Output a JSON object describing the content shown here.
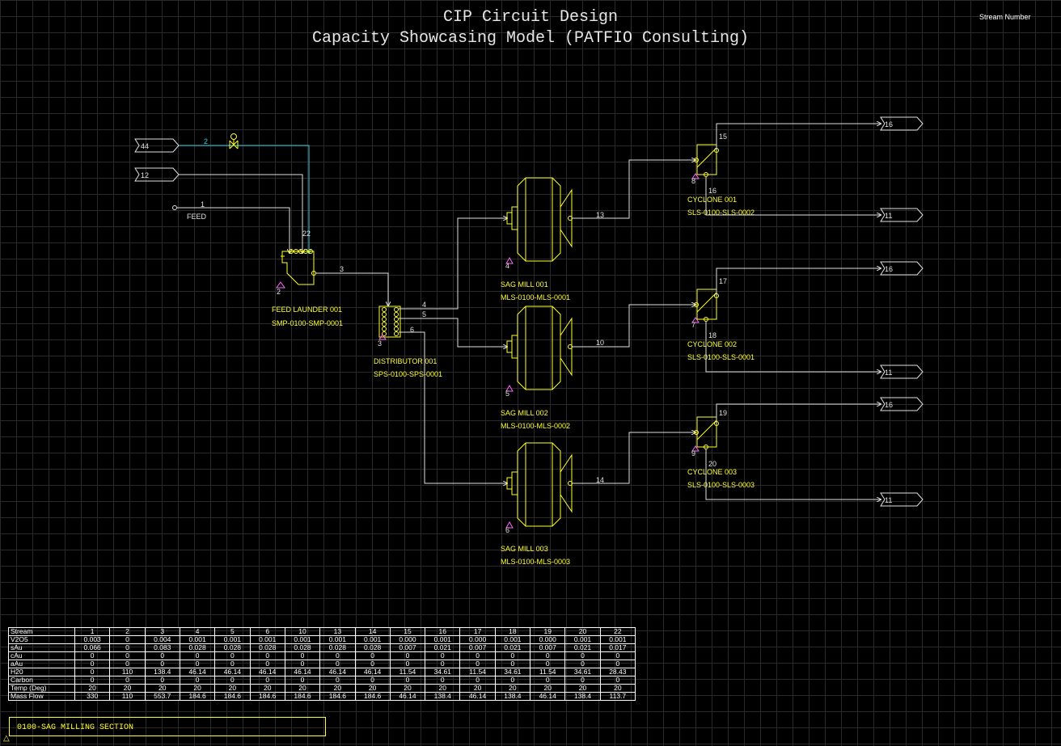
{
  "header": {
    "title": "CIP Circuit Design",
    "subtitle": "Capacity Showcasing Model (PATFIO Consulting)",
    "legend_label": "Stream Number"
  },
  "colors": {
    "background": "#000000",
    "grid": "#2a2a2a",
    "equipment": "#ffff33",
    "stream_line": "#e0e0e0",
    "water_line": "#39d0e0",
    "node_marker": "#ff66ff"
  },
  "feeds": [
    {
      "tag": "44"
    },
    {
      "tag": "12"
    },
    {
      "tag": "FEED"
    }
  ],
  "outlets": [
    {
      "tag": "16"
    },
    {
      "tag": "11"
    },
    {
      "tag": "16"
    },
    {
      "tag": "11"
    },
    {
      "tag": "16"
    },
    {
      "tag": "11"
    }
  ],
  "equipment": {
    "feed_launder": {
      "name": "FEED LAUNDER 001",
      "code": "SMP-0100-SMP-0001",
      "node": "2"
    },
    "distributor": {
      "name": "DISTRIBUTOR 001",
      "code": "SPS-0100-SPS-0001",
      "node": "3"
    },
    "sag_mill_1": {
      "name": "SAG MILL 001",
      "code": "MLS-0100-MLS-0001",
      "node": "4"
    },
    "sag_mill_2": {
      "name": "SAG MILL 002",
      "code": "MLS-0100-MLS-0002",
      "node": "5"
    },
    "sag_mill_3": {
      "name": "SAG MILL 003",
      "code": "MLS-0100-MLS-0003",
      "node": "6"
    },
    "cyclone_1": {
      "name": "CYCLONE 001",
      "code": "SLS-0100-SLS-0002",
      "node": "8"
    },
    "cyclone_2": {
      "name": "CYCLONE 002",
      "code": "SLS-0100-SLS-0001",
      "node": "7"
    },
    "cyclone_3": {
      "name": "CYCLONE 003",
      "code": "SLS-0100-SLS-0003",
      "node": "9"
    }
  },
  "streams": {
    "s1": "1",
    "s2": "2",
    "s3": "3",
    "s4": "4",
    "s5": "5",
    "s6": "6",
    "s10": "10",
    "s13": "13",
    "s14": "14",
    "s15": "15",
    "s16": "16",
    "s17": "17",
    "s18": "18",
    "s19": "19",
    "s20": "20",
    "s22": "22"
  },
  "stream_table": {
    "columns": [
      "Stream",
      "1",
      "2",
      "3",
      "4",
      "5",
      "6",
      "10",
      "13",
      "14",
      "15",
      "16",
      "17",
      "18",
      "19",
      "20",
      "22"
    ],
    "rows": [
      [
        "V2O5",
        "0.003",
        "0",
        "0.004",
        "0.001",
        "0.001",
        "0.001",
        "0.001",
        "0.001",
        "0.001",
        "0.000",
        "0.001",
        "0.000",
        "0.001",
        "0.000",
        "0.001",
        "0.001"
      ],
      [
        "sAu",
        "0.066",
        "0",
        "0.083",
        "0.028",
        "0.028",
        "0.028",
        "0.028",
        "0.028",
        "0.028",
        "0.007",
        "0.021",
        "0.007",
        "0.021",
        "0.007",
        "0.021",
        "0.017"
      ],
      [
        "cAu",
        "0",
        "0",
        "0",
        "0",
        "0",
        "0",
        "0",
        "0",
        "0",
        "0",
        "0",
        "0",
        "0",
        "0",
        "0",
        "0"
      ],
      [
        "aAu",
        "0",
        "0",
        "0",
        "0",
        "0",
        "0",
        "0",
        "0",
        "0",
        "0",
        "0",
        "0",
        "0",
        "0",
        "0",
        "0"
      ],
      [
        "H20",
        "0",
        "110",
        "138.4",
        "46.14",
        "46.14",
        "46.14",
        "46.14",
        "46.14",
        "46.14",
        "11.54",
        "34.61",
        "11.54",
        "34.61",
        "11.54",
        "34.61",
        "28.43"
      ],
      [
        "Carbon",
        "0",
        "0",
        "0",
        "0",
        "0",
        "0",
        "0",
        "0",
        "0",
        "0",
        "0",
        "0",
        "0",
        "0",
        "0",
        "0"
      ],
      [
        "Temp (Deg)",
        "20",
        "20",
        "20",
        "20",
        "20",
        "20",
        "20",
        "20",
        "20",
        "20",
        "20",
        "20",
        "20",
        "20",
        "20",
        "20"
      ],
      [
        "Mass Flow",
        "330",
        "110",
        "553.7",
        "184.6",
        "184.6",
        "184.6",
        "184.6",
        "184.6",
        "184.6",
        "46.14",
        "138.4",
        "46.14",
        "138.4",
        "46.14",
        "138.4",
        "113.7"
      ]
    ]
  },
  "footer": {
    "section_label": "0100-SAG MILLING SECTION"
  }
}
